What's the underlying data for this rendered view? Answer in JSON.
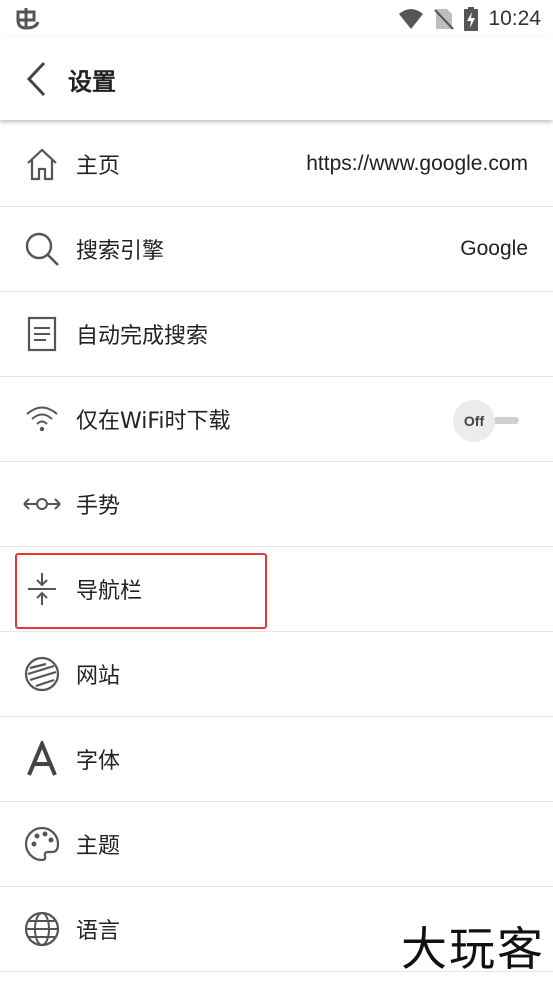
{
  "status_bar": {
    "time": "10:24",
    "left_icon": "bug-notification-icon",
    "icons": [
      "wifi-icon",
      "no-sim-icon",
      "battery-charging-icon"
    ]
  },
  "app_bar": {
    "title": "设置",
    "back_icon": "back-arrow-icon"
  },
  "settings": {
    "items": [
      {
        "label": "主页",
        "value": "https://www.google.com",
        "icon": "home-icon"
      },
      {
        "label": "搜索引擎",
        "value": "Google",
        "icon": "search-icon"
      },
      {
        "label": "自动完成搜索",
        "icon": "document-icon"
      },
      {
        "label": "仅在WiFi时下载",
        "toggle": "Off",
        "icon": "wifi-icon"
      },
      {
        "label": "手势",
        "icon": "gesture-icon"
      },
      {
        "label": "导航栏",
        "icon": "navbar-icon",
        "highlighted": true
      },
      {
        "label": "网站",
        "icon": "website-icon"
      },
      {
        "label": "字体",
        "icon": "font-icon"
      },
      {
        "label": "主题",
        "icon": "palette-icon"
      },
      {
        "label": "语言",
        "icon": "globe-icon"
      }
    ]
  },
  "colors": {
    "highlight_border": "#e53935",
    "divider": "#e6e6e6",
    "icon": "#555555"
  },
  "watermark": {
    "text": "大玩客"
  }
}
